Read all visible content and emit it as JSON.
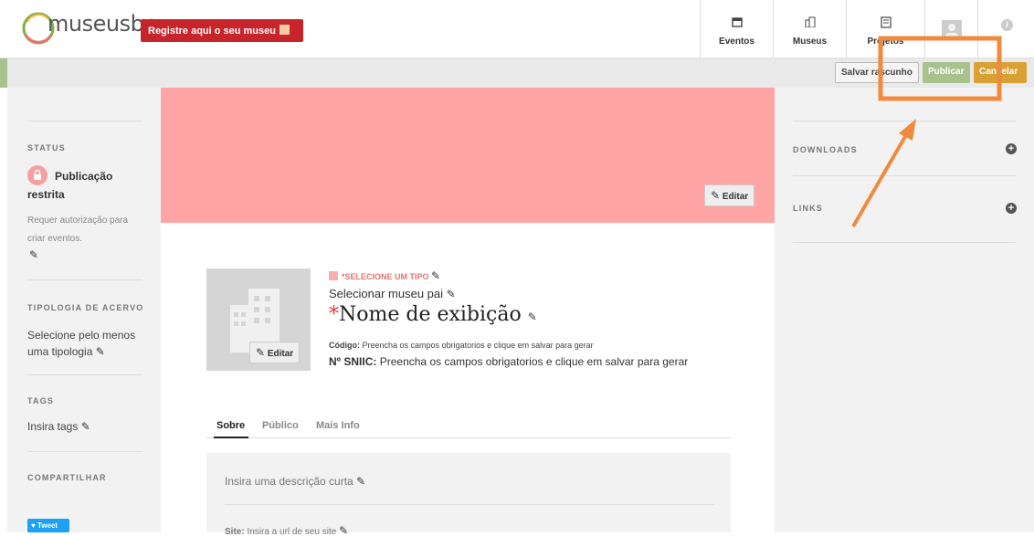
{
  "header": {
    "logo_text": "museusbr",
    "register_label": "Registre aqui o seu museu",
    "nav": [
      {
        "label": "Eventos",
        "icon": "calendar-icon"
      },
      {
        "label": "Museus",
        "icon": "building-icon"
      },
      {
        "label": "Projetos",
        "icon": "document-icon"
      }
    ]
  },
  "toolbar": {
    "save_draft": "Salvar rascunho",
    "publish": "Publicar",
    "cancel": "Cancelar"
  },
  "left": {
    "status_title": "STATUS",
    "status_value_line1": "Publicação",
    "status_value_line2": "restrita",
    "status_note_line1": "Requer autorização para",
    "status_note_line2": "criar eventos.",
    "typology_title": "TIPOLOGIA DE ACERVO",
    "typology_line1": "Selecione pelo menos",
    "typology_line2": "uma tipologia",
    "tags_title": "TAGS",
    "tags_placeholder": "Insira tags",
    "share_title": "COMPARTILHAR",
    "tweet_label": "Tweet"
  },
  "main": {
    "edit_label": "Editar",
    "type_label": "*SELECIONE UM TIPO",
    "parent_label": "Selecionar museu pai",
    "name_asterisk": "*",
    "name_label": "Nome de exibição",
    "code_key": "Código:",
    "code_value": "Preencha os campos obrigatorios e clique em salvar para gerar",
    "sniic_key": "Nº SNIIC:",
    "sniic_value": "Preencha os campos obrigatorios e clique em salvar para gerar",
    "tabs": [
      "Sobre",
      "Público",
      "Mais Info"
    ],
    "short_desc_placeholder": "Insira uma descrição curta",
    "site_label": "Site:",
    "site_placeholder": "Insira a url de seu site"
  },
  "right": {
    "downloads_title": "DOWNLOADS",
    "links_title": "LINKS"
  },
  "colors": {
    "accent_red": "#c7242b",
    "publish_green": "#a8c28e",
    "cancel_orange": "#d9a033",
    "cover_pink": "#ffa5a5",
    "annotation_orange": "#f08a3e"
  }
}
